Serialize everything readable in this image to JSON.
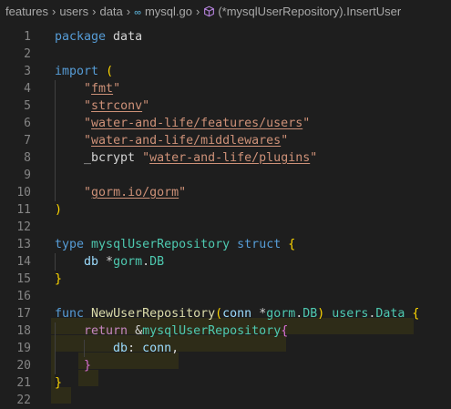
{
  "breadcrumb": {
    "items": [
      "features",
      "users",
      "data"
    ],
    "file_icon": "go",
    "file": "mysql.go",
    "symbol": "(*mysqlUserRepository).InsertUser"
  },
  "colors": {
    "background": "#1e1e1e",
    "keyword": "#569cd6",
    "string": "#ce9178",
    "type": "#4ec9b0",
    "function": "#dcdcaa",
    "identifier": "#9cdcfe",
    "bracket_gold": "#ffd700",
    "bracket_orchid": "#da70d6",
    "bracket_blue": "#179fff",
    "line_number": "#858585"
  },
  "lines": [
    {
      "n": "1",
      "t": [
        {
          "c": "kw",
          "v": "package"
        },
        {
          "c": "txt",
          "v": " data"
        }
      ]
    },
    {
      "n": "2",
      "t": []
    },
    {
      "n": "3",
      "t": [
        {
          "c": "kw",
          "v": "import"
        },
        {
          "c": "txt",
          "v": " "
        },
        {
          "c": "br1",
          "v": "("
        }
      ]
    },
    {
      "n": "4",
      "t": [
        {
          "c": "txt",
          "v": "    "
        },
        {
          "c": "q",
          "v": "\""
        },
        {
          "c": "str",
          "v": "fmt"
        },
        {
          "c": "q",
          "v": "\""
        }
      ]
    },
    {
      "n": "5",
      "t": [
        {
          "c": "txt",
          "v": "    "
        },
        {
          "c": "q",
          "v": "\""
        },
        {
          "c": "str",
          "v": "strconv"
        },
        {
          "c": "q",
          "v": "\""
        }
      ]
    },
    {
      "n": "6",
      "t": [
        {
          "c": "txt",
          "v": "    "
        },
        {
          "c": "q",
          "v": "\""
        },
        {
          "c": "str",
          "v": "water-and-life/features/users"
        },
        {
          "c": "q",
          "v": "\""
        }
      ]
    },
    {
      "n": "7",
      "t": [
        {
          "c": "txt",
          "v": "    "
        },
        {
          "c": "q",
          "v": "\""
        },
        {
          "c": "str",
          "v": "water-and-life/middlewares"
        },
        {
          "c": "q",
          "v": "\""
        }
      ]
    },
    {
      "n": "8",
      "t": [
        {
          "c": "txt",
          "v": "    _bcrypt "
        },
        {
          "c": "q",
          "v": "\""
        },
        {
          "c": "str",
          "v": "water-and-life/plugins"
        },
        {
          "c": "q",
          "v": "\""
        }
      ]
    },
    {
      "n": "9",
      "t": []
    },
    {
      "n": "10",
      "t": [
        {
          "c": "txt",
          "v": "    "
        },
        {
          "c": "q",
          "v": "\""
        },
        {
          "c": "str",
          "v": "gorm.io/gorm"
        },
        {
          "c": "q",
          "v": "\""
        }
      ]
    },
    {
      "n": "11",
      "t": [
        {
          "c": "br1",
          "v": ")"
        }
      ]
    },
    {
      "n": "12",
      "t": []
    },
    {
      "n": "13",
      "t": [
        {
          "c": "kw",
          "v": "type"
        },
        {
          "c": "txt",
          "v": " "
        },
        {
          "c": "type",
          "v": "mysqlUserRepository"
        },
        {
          "c": "txt",
          "v": " "
        },
        {
          "c": "kw",
          "v": "struct"
        },
        {
          "c": "txt",
          "v": " "
        },
        {
          "c": "br1",
          "v": "{"
        }
      ]
    },
    {
      "n": "14",
      "t": [
        {
          "c": "txt",
          "v": "    "
        },
        {
          "c": "id",
          "v": "db"
        },
        {
          "c": "txt",
          "v": " *"
        },
        {
          "c": "type",
          "v": "gorm"
        },
        {
          "c": "txt",
          "v": "."
        },
        {
          "c": "type",
          "v": "DB"
        }
      ]
    },
    {
      "n": "15",
      "t": [
        {
          "c": "br1",
          "v": "}"
        }
      ]
    },
    {
      "n": "16",
      "t": []
    },
    {
      "n": "17",
      "t": [
        {
          "c": "kw",
          "v": "func"
        },
        {
          "c": "txt",
          "v": " "
        },
        {
          "c": "fn",
          "v": "NewUserRepository"
        },
        {
          "c": "br1",
          "v": "("
        },
        {
          "c": "id",
          "v": "conn"
        },
        {
          "c": "txt",
          "v": " *"
        },
        {
          "c": "type",
          "v": "gorm"
        },
        {
          "c": "txt",
          "v": "."
        },
        {
          "c": "type",
          "v": "DB"
        },
        {
          "c": "br1",
          "v": ")"
        },
        {
          "c": "txt",
          "v": " "
        },
        {
          "c": "type",
          "v": "users"
        },
        {
          "c": "txt",
          "v": "."
        },
        {
          "c": "type",
          "v": "Data"
        },
        {
          "c": "txt",
          "v": " "
        },
        {
          "c": "br1",
          "v": "{"
        }
      ]
    },
    {
      "n": "18",
      "t": [
        {
          "c": "txt",
          "v": "    "
        },
        {
          "c": "kwc",
          "v": "return"
        },
        {
          "c": "txt",
          "v": " &"
        },
        {
          "c": "type",
          "v": "mysqlUserRepository"
        },
        {
          "c": "br2",
          "v": "{"
        }
      ]
    },
    {
      "n": "19",
      "t": [
        {
          "c": "txt",
          "v": "        "
        },
        {
          "c": "id",
          "v": "db"
        },
        {
          "c": "txt",
          "v": ": "
        },
        {
          "c": "id",
          "v": "conn"
        },
        {
          "c": "txt",
          "v": ","
        }
      ]
    },
    {
      "n": "20",
      "t": [
        {
          "c": "txt",
          "v": "    "
        },
        {
          "c": "br2",
          "v": "}"
        }
      ]
    },
    {
      "n": "21",
      "t": [
        {
          "c": "br1",
          "v": "}"
        }
      ]
    },
    {
      "n": "22",
      "t": []
    }
  ]
}
